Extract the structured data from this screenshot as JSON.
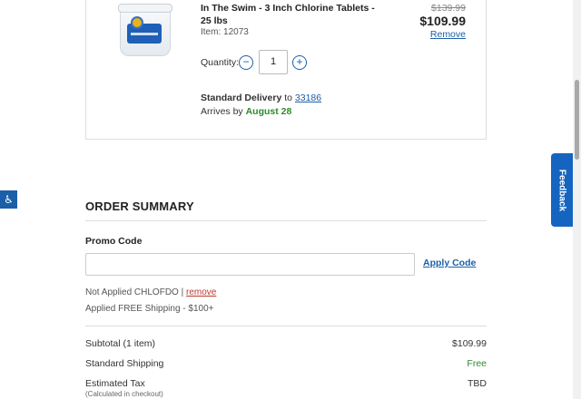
{
  "product": {
    "title": "In The Swim - 3 Inch Chlorine Tablets - 25 lbs",
    "item": "Item: 12073",
    "original_price": "$139.99",
    "price": "$109.99",
    "remove_label": "Remove",
    "quantity_label": "Quantity:",
    "quantity_value": "1",
    "minus_symbol": "−",
    "plus_symbol": "+",
    "delivery_method": "Standard Delivery",
    "delivery_to": " to ",
    "zip": "33186",
    "arrives_prefix": "Arrives by ",
    "arrives_date": "August 28"
  },
  "accessibility": {
    "icon": "accessibility-icon",
    "symbol": "♿"
  },
  "feedback": {
    "label": "Feedback"
  },
  "summary": {
    "title": "ORDER SUMMARY",
    "promo_label": "Promo Code",
    "promo_placeholder": "",
    "apply_label": "Apply Code",
    "not_applied_text": "Not Applied CHLOFDO | ",
    "remove_promo_label": "remove",
    "applied_text": "Applied FREE Shipping - $100+",
    "rows": [
      {
        "label": "Subtotal (1 item)",
        "value": "$109.99"
      },
      {
        "label": "Standard Shipping",
        "value": "Free"
      },
      {
        "label": "Estimated Tax",
        "value": "TBD",
        "sub": "(Calculated in checkout)"
      }
    ]
  },
  "colors": {
    "link": "#1a5fa8",
    "green": "#2c8a2c",
    "feedback": "#1565c0",
    "remove_red": "#c0392b"
  }
}
